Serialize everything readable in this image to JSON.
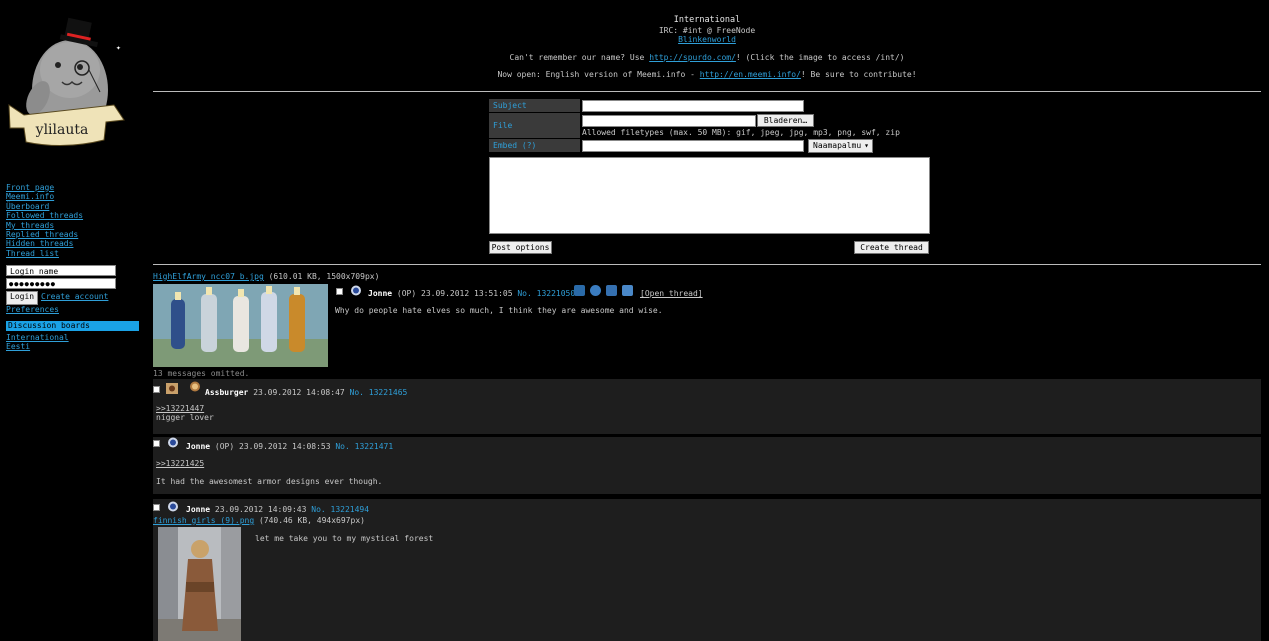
{
  "sidebar": {
    "logo_text": "ylilauta",
    "nav": [
      "Front page",
      "Meemi.info",
      "Überboard",
      "Followed threads",
      "My threads",
      "Replied threads",
      "Hidden threads",
      "Thread list"
    ],
    "login": {
      "name_placeholder": "Login name",
      "password_mask": "●●●●●●●●●",
      "login_button": "Login",
      "create_account": "Create account",
      "preferences": "Preferences"
    },
    "boards_header": "Discussion boards",
    "boards": [
      "International",
      "Eesti"
    ]
  },
  "header": {
    "title": "International",
    "irc": "IRC: #int @ FreeNode",
    "irc_link": "Blinkenworld",
    "remember_prefix": "Can't remember our name? Use ",
    "remember_link": "http://spurdo.com/",
    "remember_suffix": "! (Click the image to access /int/)",
    "open_prefix": "Now open: English version of Meemi.info - ",
    "open_link": "http://en.meemi.info/",
    "open_suffix": "! Be sure to contribute!"
  },
  "form": {
    "subject_label": "Subject",
    "file_label": "File",
    "browse_button": "Bladeren…",
    "filetypes": "Allowed filetypes (max. 50 MB): gif, jpeg, jpg, mp3, png, swf, zip",
    "embed_label": "Embed (?)",
    "embed_select": "Naamapalmu",
    "post_options": "Post options",
    "create_thread": "Create thread"
  },
  "thread": {
    "op": {
      "file_name": "HighElfArmy_ncc07_b.jpg",
      "file_info": "(610.01 KB, 1500x709px)",
      "name": "Jonne",
      "op_tag": "(OP)",
      "date": "23.09.2012 13:51:05",
      "post_no": "No. 13221050",
      "open_thread": "[Open thread]",
      "message": "Why do people hate elves so much, I think they are awesome and wise."
    },
    "omitted": "13 messages omitted.",
    "replies": [
      {
        "name": "Assburger",
        "op_tag": "",
        "date": "23.09.2012 14:08:47",
        "post_no": "No. 13221465",
        "quote": ">>13221447",
        "message": "nigger lover"
      },
      {
        "name": "Jonne",
        "op_tag": "(OP)",
        "date": "23.09.2012 14:08:53",
        "post_no": "No. 13221471",
        "quote": ">>13221425",
        "message": "It had the awesomest armor designs ever though."
      },
      {
        "name": "Jonne",
        "op_tag": "",
        "date": "23.09.2012 14:09:43",
        "post_no": "No. 13221494",
        "file_name": "finnish girls (9).png",
        "file_info": "(740.46 KB, 494x697px)",
        "message": "let me take you to my mystical forest"
      }
    ]
  },
  "colors": {
    "background": "#000000",
    "link": "#2f9fd8",
    "reply_background": "#1e1e1e",
    "boards_header": "#1aa2e6"
  }
}
